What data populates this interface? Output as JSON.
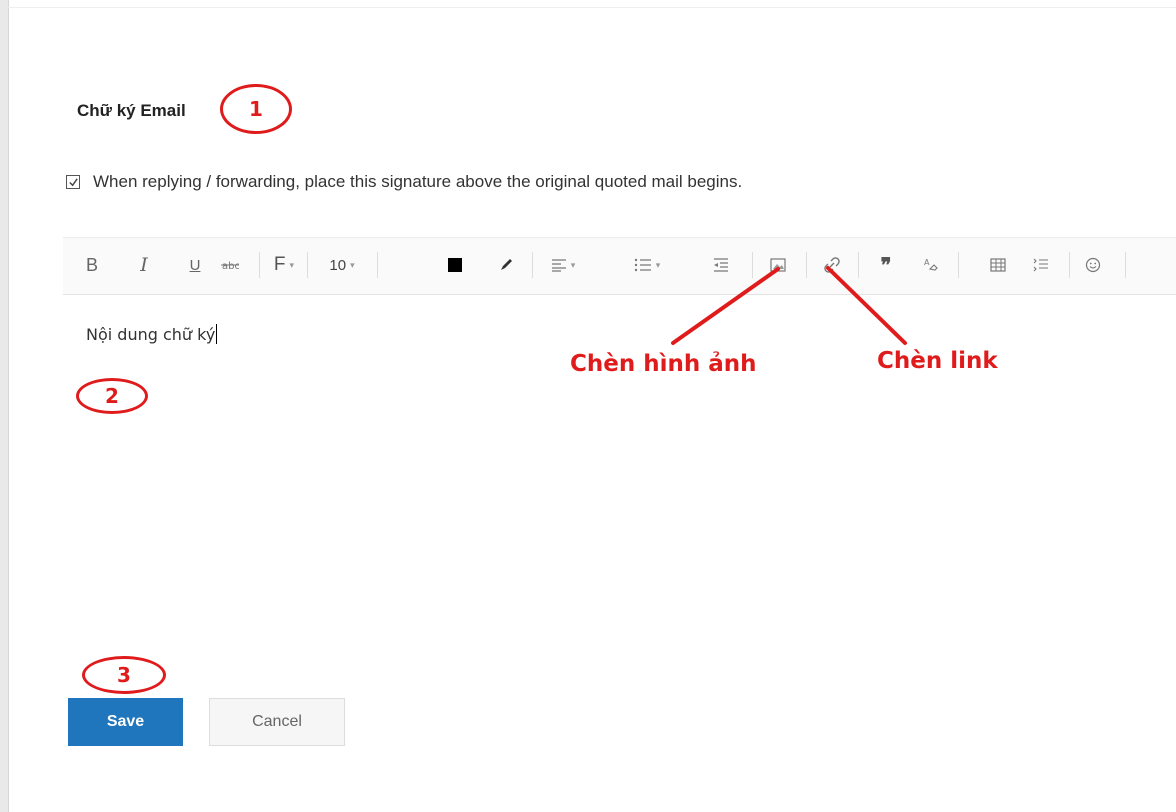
{
  "title": "Chữ ký Email",
  "signature_option": {
    "checked": true,
    "label": "When replying / forwarding, place this signature above the original quoted mail begins."
  },
  "toolbar": {
    "bold": "B",
    "italic": "I",
    "underline": "U",
    "font_family": "F",
    "font_size": "10",
    "text_color": "#000000"
  },
  "editor": {
    "content": "Nội dung chữ ký"
  },
  "annotations": {
    "step1": "1",
    "step2": "2",
    "step3": "3",
    "insert_image": "Chèn hình ảnh",
    "insert_link": "Chèn link",
    "color": "#e01b1b"
  },
  "buttons": {
    "save": "Save",
    "cancel": "Cancel"
  }
}
